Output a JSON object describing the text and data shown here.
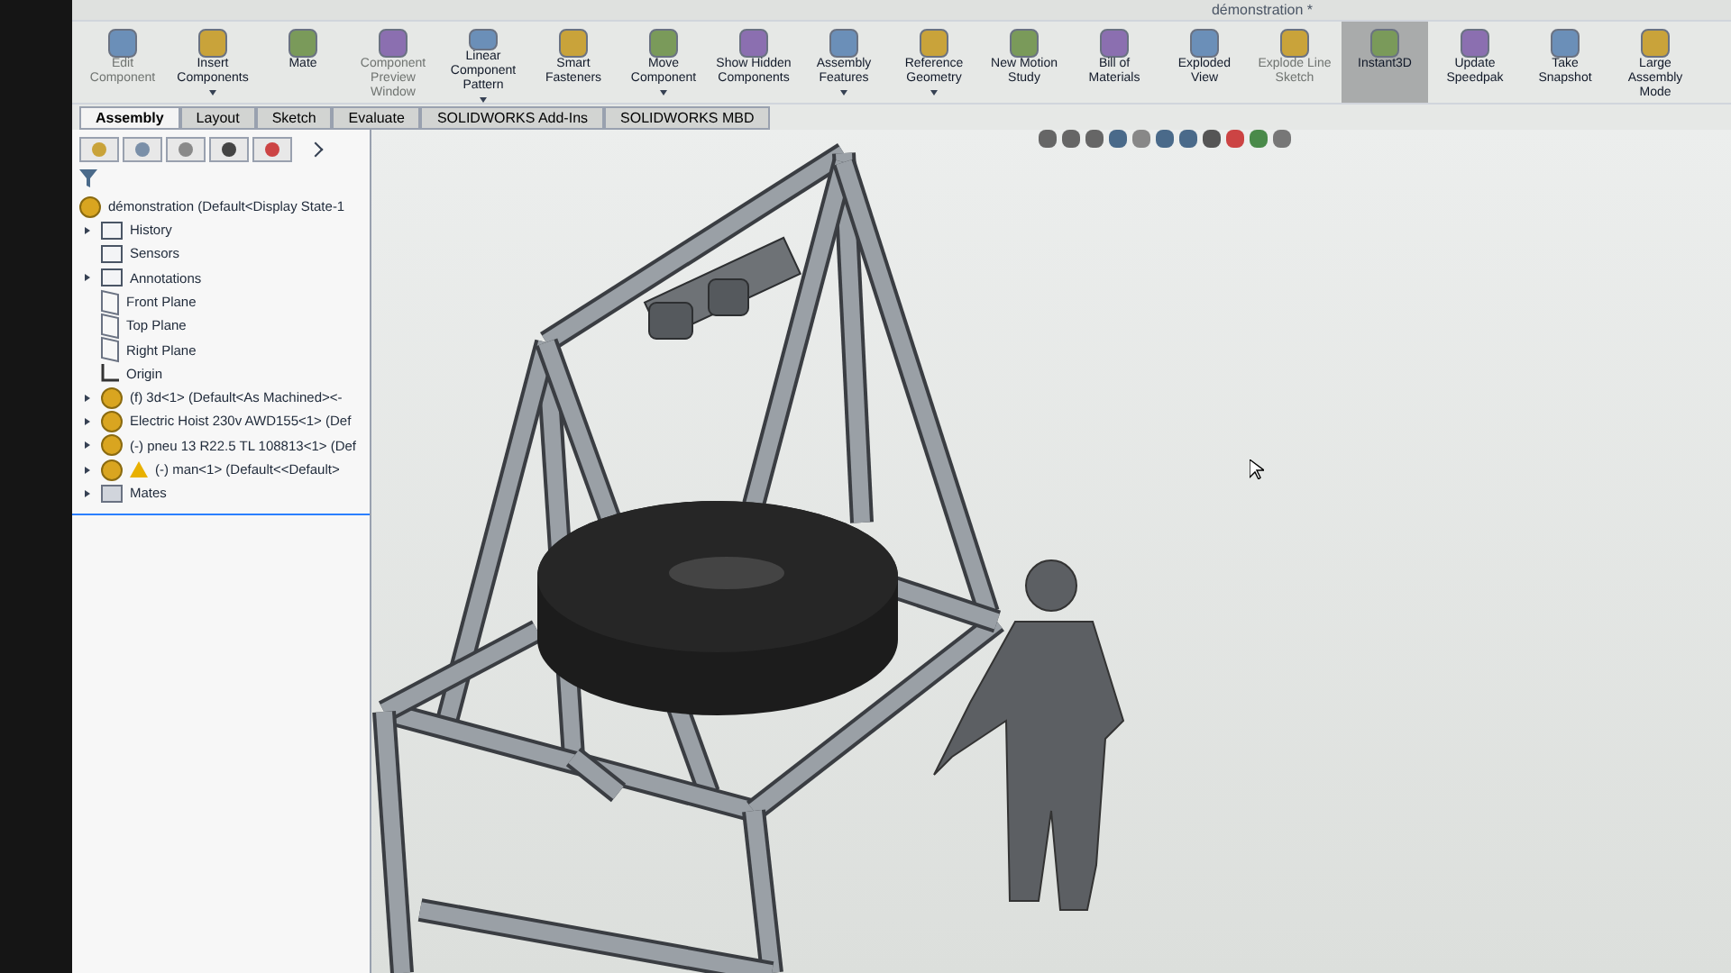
{
  "window": {
    "title": "démonstration *"
  },
  "ribbon": [
    {
      "label": "Edit Component",
      "disabled": true,
      "dropdown": false,
      "selected": false
    },
    {
      "label": "Insert Components",
      "disabled": false,
      "dropdown": true,
      "selected": false
    },
    {
      "label": "Mate",
      "disabled": false,
      "dropdown": false,
      "selected": false
    },
    {
      "label": "Component Preview Window",
      "disabled": true,
      "dropdown": false,
      "selected": false
    },
    {
      "label": "Linear Component Pattern",
      "disabled": false,
      "dropdown": true,
      "selected": false
    },
    {
      "label": "Smart Fasteners",
      "disabled": false,
      "dropdown": false,
      "selected": false
    },
    {
      "label": "Move Component",
      "disabled": false,
      "dropdown": true,
      "selected": false
    },
    {
      "label": "Show Hidden Components",
      "disabled": false,
      "dropdown": false,
      "selected": false
    },
    {
      "label": "Assembly Features",
      "disabled": false,
      "dropdown": true,
      "selected": false
    },
    {
      "label": "Reference Geometry",
      "disabled": false,
      "dropdown": true,
      "selected": false
    },
    {
      "label": "New Motion Study",
      "disabled": false,
      "dropdown": false,
      "selected": false
    },
    {
      "label": "Bill of Materials",
      "disabled": false,
      "dropdown": false,
      "selected": false
    },
    {
      "label": "Exploded View",
      "disabled": false,
      "dropdown": false,
      "selected": false
    },
    {
      "label": "Explode Line Sketch",
      "disabled": true,
      "dropdown": false,
      "selected": false
    },
    {
      "label": "Instant3D",
      "disabled": false,
      "dropdown": false,
      "selected": true
    },
    {
      "label": "Update Speedpak",
      "disabled": false,
      "dropdown": false,
      "selected": false
    },
    {
      "label": "Take Snapshot",
      "disabled": false,
      "dropdown": false,
      "selected": false
    },
    {
      "label": "Large Assembly Mode",
      "disabled": false,
      "dropdown": false,
      "selected": false
    }
  ],
  "tabs": [
    {
      "label": "Assembly",
      "selected": true
    },
    {
      "label": "Layout",
      "selected": false
    },
    {
      "label": "Sketch",
      "selected": false
    },
    {
      "label": "Evaluate",
      "selected": false
    },
    {
      "label": "SOLIDWORKS Add-Ins",
      "selected": false
    },
    {
      "label": "SOLIDWORKS MBD",
      "selected": false
    }
  ],
  "tree": {
    "root": "démonstration  (Default<Display State-1",
    "children": [
      {
        "kind": "folder",
        "label": "History",
        "expandable": true,
        "warning": false
      },
      {
        "kind": "folder",
        "label": "Sensors",
        "expandable": false,
        "warning": false
      },
      {
        "kind": "folder",
        "label": "Annotations",
        "expandable": true,
        "warning": false
      },
      {
        "kind": "plane",
        "label": "Front Plane",
        "expandable": false,
        "warning": false
      },
      {
        "kind": "plane",
        "label": "Top Plane",
        "expandable": false,
        "warning": false
      },
      {
        "kind": "plane",
        "label": "Right Plane",
        "expandable": false,
        "warning": false
      },
      {
        "kind": "origin",
        "label": "Origin",
        "expandable": false,
        "warning": false
      },
      {
        "kind": "component",
        "label": "(f) 3d<1> (Default<As Machined><-",
        "expandable": true,
        "warning": false
      },
      {
        "kind": "component",
        "label": "Electric Hoist 230v AWD155<1> (Def",
        "expandable": true,
        "warning": false
      },
      {
        "kind": "component",
        "label": "(-) pneu 13 R22.5 TL 108813<1> (Def",
        "expandable": true,
        "warning": false
      },
      {
        "kind": "component",
        "label": "(-) man<1> (Default<<Default>",
        "expandable": true,
        "warning": true
      },
      {
        "kind": "mates",
        "label": "Mates",
        "expandable": true,
        "warning": false
      }
    ]
  }
}
